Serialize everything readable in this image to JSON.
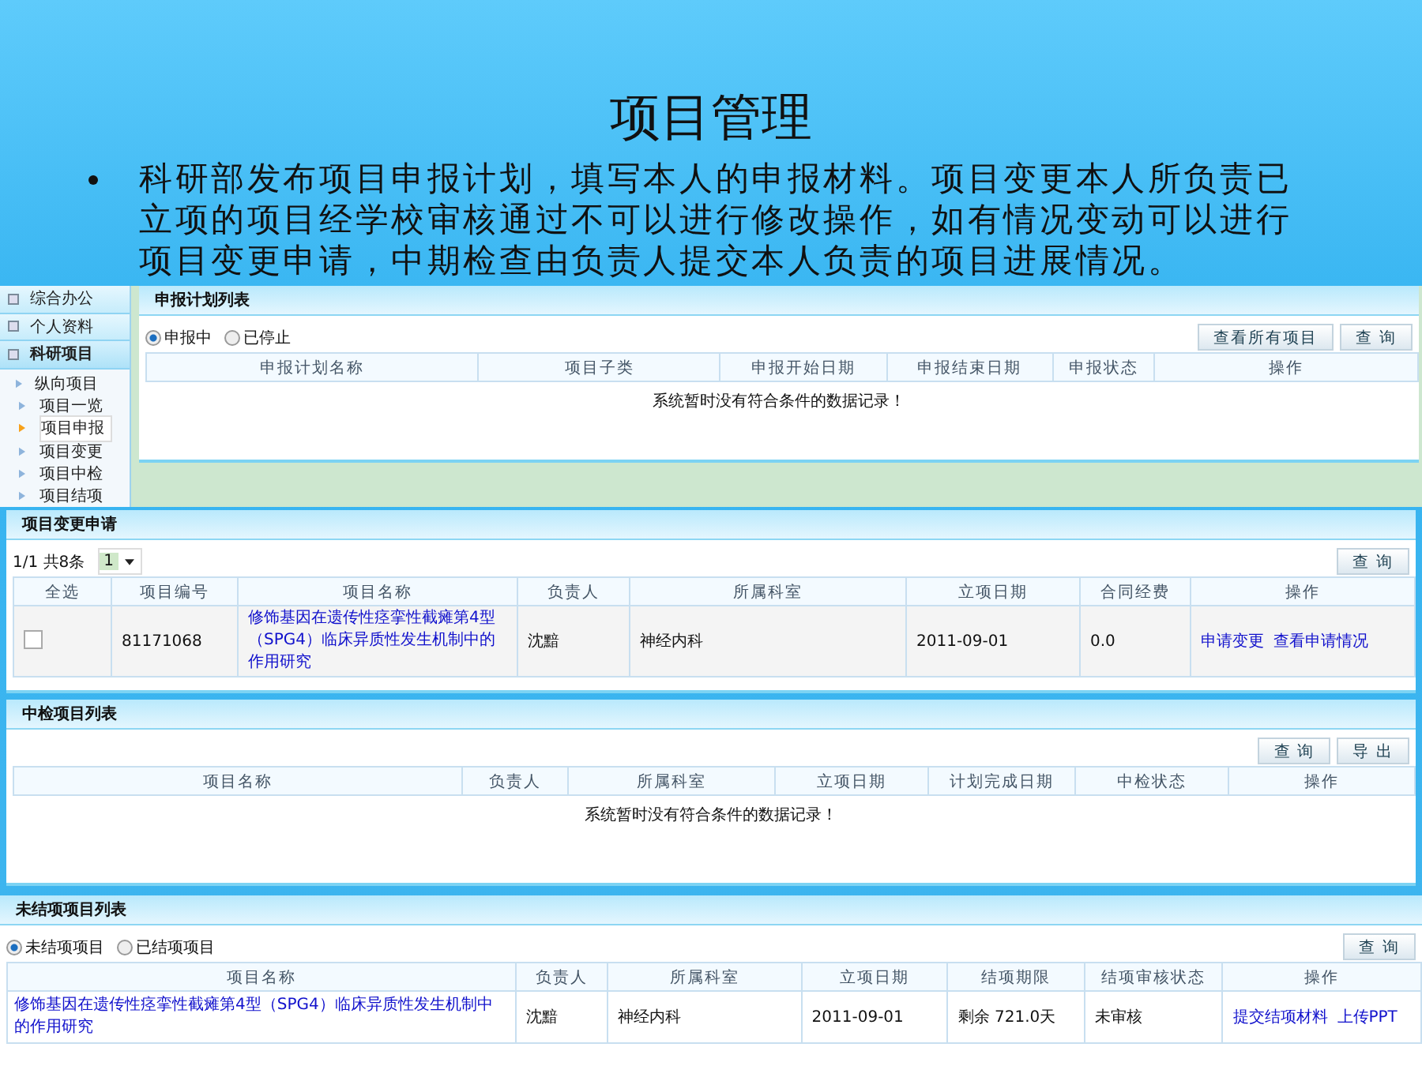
{
  "slide": {
    "title": "项目管理",
    "bullet": "科研部发布项目申报计划，填写本人的申报材料。项目变更本人所负责已立项的项目经学校审核通过不可以进行修改操作，如有情况变动可以进行项目变更申请，中期检查由负责人提交本人负责的项目进展情况。"
  },
  "sidebar": {
    "groups": [
      {
        "label": "综合办公",
        "selected": false
      },
      {
        "label": "个人资料",
        "selected": false
      },
      {
        "label": "科研项目",
        "selected": true
      }
    ],
    "items": [
      {
        "label": "纵向项目",
        "children": [
          {
            "label": "项目一览",
            "selected": false
          },
          {
            "label": "项目申报",
            "selected": true
          },
          {
            "label": "项目变更",
            "selected": false
          },
          {
            "label": "项目中检",
            "selected": false
          },
          {
            "label": "项目结项",
            "selected": false
          }
        ]
      }
    ]
  },
  "plan_panel": {
    "title": "申报计划列表",
    "radios": [
      {
        "label": "申报中",
        "selected": true
      },
      {
        "label": "已停止",
        "selected": false
      }
    ],
    "buttons": [
      "查看所有项目",
      "查 询"
    ],
    "columns": [
      "申报计划名称",
      "项目子类",
      "申报开始日期",
      "申报结束日期",
      "申报状态",
      "操作"
    ],
    "empty_message": "系统暂时没有符合条件的数据记录！"
  },
  "change_panel": {
    "title": "项目变更申请",
    "pager": "1/1 共8条",
    "page_select": "1",
    "buttons": [
      "查 询"
    ],
    "columns": [
      "全选",
      "项目编号",
      "项目名称",
      "负责人",
      "所属科室",
      "立项日期",
      "合同经费",
      "操作"
    ],
    "rows": [
      {
        "checked": false,
        "number": "81171068",
        "name": "修饰基因在遗传性痉挛性截瘫第4型（SPG4）临床异质性发生机制中的作用研究",
        "leader": "沈黯",
        "department": "神经内科",
        "date": "2011-09-01",
        "funds": "0.0",
        "actions": [
          "申请变更",
          "查看申请情况"
        ]
      }
    ]
  },
  "midterm_panel": {
    "title": "中检项目列表",
    "buttons": [
      "查 询",
      "导 出"
    ],
    "columns": [
      "项目名称",
      "负责人",
      "所属科室",
      "立项日期",
      "计划完成日期",
      "中检状态",
      "操作"
    ],
    "empty_message": "系统暂时没有符合条件的数据记录！"
  },
  "closing_panel": {
    "title": "未结项项目列表",
    "radios": [
      {
        "label": "未结项项目",
        "selected": true
      },
      {
        "label": "已结项项目",
        "selected": false
      }
    ],
    "buttons": [
      "查 询"
    ],
    "columns": [
      "项目名称",
      "负责人",
      "所属科室",
      "立项日期",
      "结项期限",
      "结项审核状态",
      "操作"
    ],
    "rows": [
      {
        "name": "修饰基因在遗传性痉挛性截瘫第4型（SPG4）临床异质性发生机制中的作用研究",
        "leader": "沈黯",
        "department": "神经内科",
        "date": "2011-09-01",
        "deadline": "剩余 721.0天",
        "status": "未审核",
        "actions": [
          "提交结项材料",
          "上传PPT"
        ]
      }
    ]
  }
}
